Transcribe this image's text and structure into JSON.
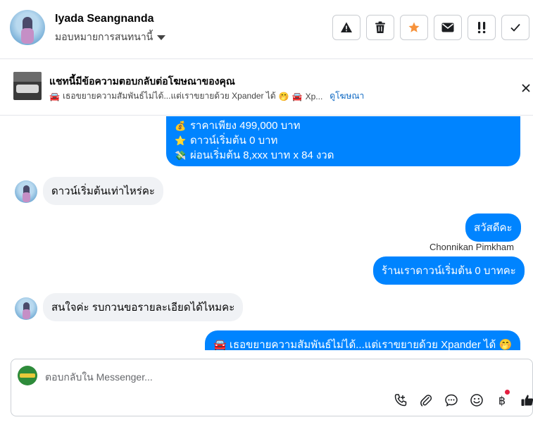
{
  "header": {
    "contact_name": "Iyada Seangnanda",
    "assign_label": "มอบหมายการสนทนานี้",
    "actions": [
      {
        "name": "report-button",
        "icon": "warning-icon"
      },
      {
        "name": "delete-button",
        "icon": "trash-icon"
      },
      {
        "name": "star-button",
        "icon": "star-icon"
      },
      {
        "name": "mark-unread-button",
        "icon": "envelope-icon"
      },
      {
        "name": "follow-up-button",
        "icon": "double-exclamation-icon"
      },
      {
        "name": "mark-done-button",
        "icon": "check-icon"
      }
    ],
    "star_color": "#f7923b"
  },
  "ad_banner": {
    "title": "แชทนี้มีข้อความตอบกลับต่อโฆษณาของคุณ",
    "snippet_emoji_1": "🚘",
    "snippet": "เธอขยายความสัมพันธ์ไม่ได้...แต่เราขยายด้วย Xpander ได้",
    "snippet_emoji_2": "🤭",
    "snippet_emoji_3": "🚘",
    "snippet_tail": "Xp...",
    "view_ad_link": "ดูโฆษณา"
  },
  "messages": {
    "out_1": [
      {
        "emoji": "💰",
        "text": "ราคาเพียง 499,000 บาท"
      },
      {
        "emoji": "⭐",
        "text": "ดาวน์เริ่มต้น 0 บาท"
      },
      {
        "emoji": "💸",
        "text": "ผ่อนเริ่มต้น 8,xxx บาท x 84 งวด"
      }
    ],
    "in_1": "ดาวน์เริ่มต้นเท่าไหร่คะ",
    "out_2": "สวัสดีคะ",
    "sender_name": "Chonnikan Pimkham",
    "out_3": "ร้านเราดาวน์เริ่มต้น 0 บาทคะ",
    "in_2": "สนใจค่ะ รบกวนขอรายละเอียดได้ไหมคะ",
    "out_4_emoji": "🚘",
    "out_4": "เธอขยายความสัมพันธ์ไม่ได้...แต่เราขยายด้วย Xpander ได้",
    "out_4_emoji_end": "🤭",
    "outgoing_color": "#0084ff"
  },
  "composer": {
    "placeholder": "ตอบกลับใน Messenger...",
    "tools": [
      "call-add-icon",
      "attachment-icon",
      "saved-reply-icon",
      "emoji-icon",
      "baht-payment-icon",
      "thumbs-up-icon"
    ]
  }
}
